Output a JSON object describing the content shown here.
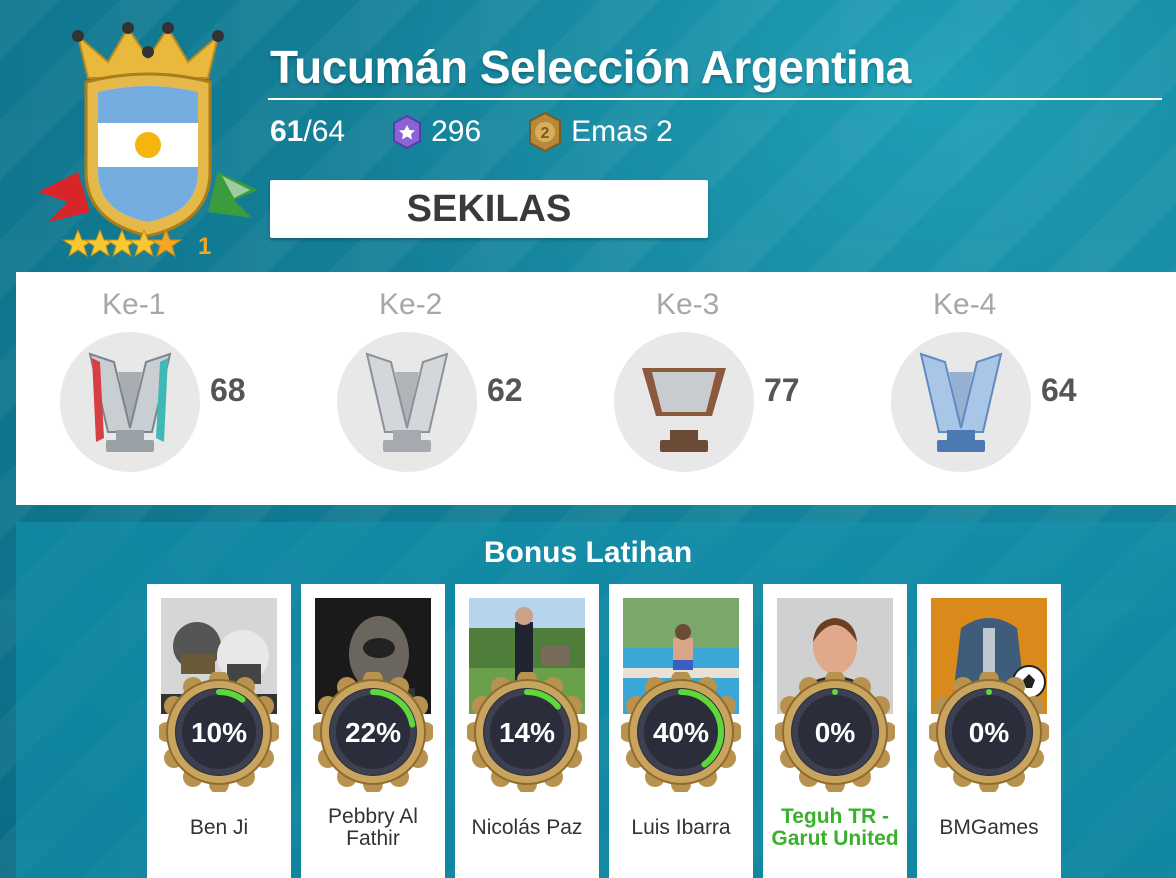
{
  "team": {
    "name": "Tucumán Selección Argentina",
    "rating_current": "61",
    "rating_max": "/64",
    "gems": "296",
    "medal_level": "2",
    "medal_label": "Emas 2",
    "badge_stars": 4.5,
    "badge_number": "1",
    "flag": "argentina"
  },
  "preview_button": {
    "label": "SEKILAS"
  },
  "trophies": [
    {
      "rank": "Ke-1",
      "count": "68",
      "style": "silver-ribbons"
    },
    {
      "rank": "Ke-2",
      "count": "62",
      "style": "silver"
    },
    {
      "rank": "Ke-3",
      "count": "77",
      "style": "bronze"
    },
    {
      "rank": "Ke-4",
      "count": "64",
      "style": "blue"
    }
  ],
  "bonus": {
    "title": "Bonus Latihan",
    "cards": [
      {
        "name": "Ben Ji",
        "percent_label": "10%",
        "percent": 0.1,
        "highlight": false,
        "photo": "masked-kids"
      },
      {
        "name": "Pebbry Al Fathir",
        "percent_label": "22%",
        "percent": 0.22,
        "highlight": false,
        "photo": "masked-figure"
      },
      {
        "name": "Nicolás Paz",
        "percent_label": "14%",
        "percent": 0.14,
        "highlight": false,
        "photo": "man-in-suit-garden"
      },
      {
        "name": "Luis Ibarra",
        "percent_label": "40%",
        "percent": 0.4,
        "highlight": false,
        "photo": "boy-by-pool"
      },
      {
        "name": "Teguh TR - Garut United",
        "percent_label": "0%",
        "percent": 0.0,
        "highlight": true,
        "photo": "default-avatar"
      },
      {
        "name": "BMGames",
        "percent_label": "0%",
        "percent": 0.0,
        "highlight": false,
        "photo": "manager-with-ball"
      }
    ]
  },
  "colors": {
    "accent_green": "#3ab02c",
    "progress_green": "#5cd83a",
    "gold": "#c9a24a",
    "background": "#0f7d94"
  }
}
